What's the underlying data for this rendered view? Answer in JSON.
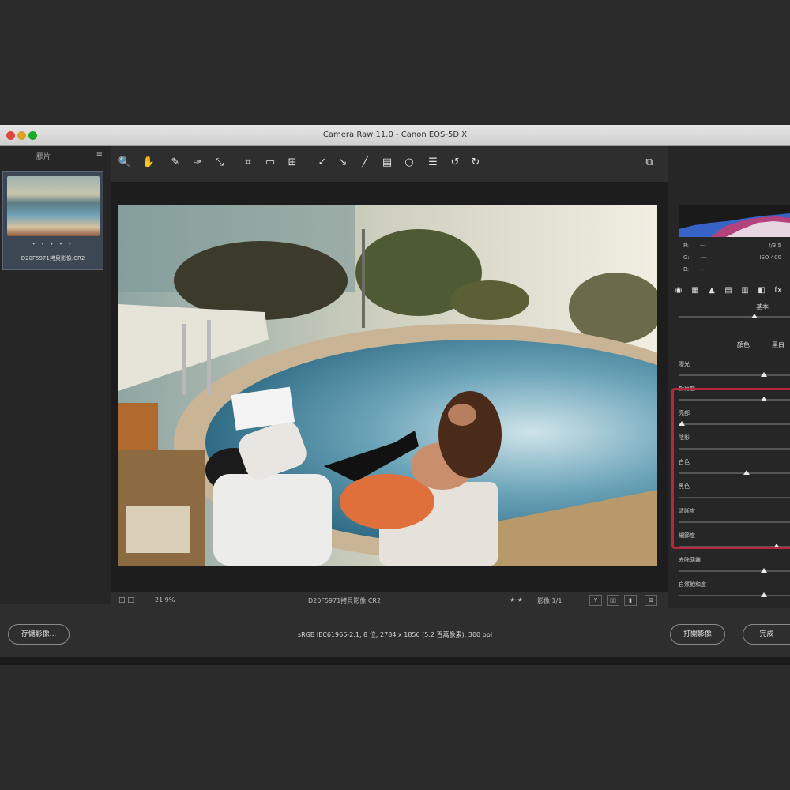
{
  "window": {
    "title": "Camera Raw 11.0 - Canon EOS-5D X"
  },
  "filmstrip": {
    "header_label": "膠片",
    "menu_icon": "hamburger-icon",
    "thumbnail": {
      "rating": "• • • • •",
      "file_name": "D20F5971拷貝影像.CR2"
    }
  },
  "toolbar": {
    "tools": [
      {
        "name": "zoom-tool",
        "icon": "🔍"
      },
      {
        "name": "hand-tool",
        "icon": "✋"
      },
      {
        "name": "white-balance-tool",
        "icon": "✎"
      },
      {
        "name": "color-sampler-tool",
        "icon": "✑"
      },
      {
        "name": "targeted-adjustment-tool",
        "icon": "⤡"
      },
      {
        "name": "crop-tool",
        "icon": "⌗"
      },
      {
        "name": "straighten-tool",
        "icon": "▭"
      },
      {
        "name": "transform-tool",
        "icon": "⊞"
      },
      {
        "name": "spot-removal-tool",
        "icon": "✓"
      },
      {
        "name": "red-eye-tool",
        "icon": "↘"
      },
      {
        "name": "adjustment-brush-tool",
        "icon": "╱"
      },
      {
        "name": "graduated-filter-tool",
        "icon": "▤"
      },
      {
        "name": "radial-filter-tool",
        "icon": "○"
      },
      {
        "name": "preferences-tool",
        "icon": "☰"
      },
      {
        "name": "rotate-ccw-tool",
        "icon": "↺"
      },
      {
        "name": "rotate-cw-tool",
        "icon": "↻"
      }
    ],
    "right_icon": "⧉"
  },
  "status": {
    "zoom_icons": "□ □",
    "zoom_value": "21.9%",
    "file_name": "D20F5971拷貝影像.CR2",
    "rating_nav": "★ ★",
    "image_count": "影像 1/1",
    "view_buttons": [
      "Y",
      "▯▯",
      "▮",
      "⊞"
    ]
  },
  "right_panel": {
    "rgb": [
      {
        "label": "R:",
        "dash": "---",
        "value": "f/3.5"
      },
      {
        "label": "G:",
        "dash": "---",
        "value": "ISO 400"
      },
      {
        "label": "B:",
        "dash": "---",
        "value": ""
      }
    ],
    "tabs": [
      "◉",
      "▦",
      "▲",
      "▤",
      "▥",
      "◧",
      "fx"
    ],
    "section_title": "基本",
    "treatment": {
      "color": "顏色",
      "bw": "黑白"
    },
    "sliders": [
      {
        "label": "曝光",
        "level": 0.78
      },
      {
        "label": "對比度",
        "level": 0.78
      },
      {
        "label": "亮部",
        "level": 0.0
      },
      {
        "label": "陰影",
        "level": null
      },
      {
        "label": "白色",
        "level": 0.62
      },
      {
        "label": "黑色",
        "level": null
      },
      {
        "label": "清晰度",
        "level": null
      },
      {
        "label": "細節度",
        "level": 0.9
      },
      {
        "label": "去除薄霧",
        "level": 0.78
      },
      {
        "label": "自然飽和度",
        "level": 0.78
      }
    ]
  },
  "bottom": {
    "save_button": "存儲影像...",
    "workflow_link": "sRGB IEC61966-2.1; 8 位; 2784 x 1856 (5.2 百萬像素); 300 ppi",
    "open_button": "打開影像",
    "done_button": "完成"
  }
}
